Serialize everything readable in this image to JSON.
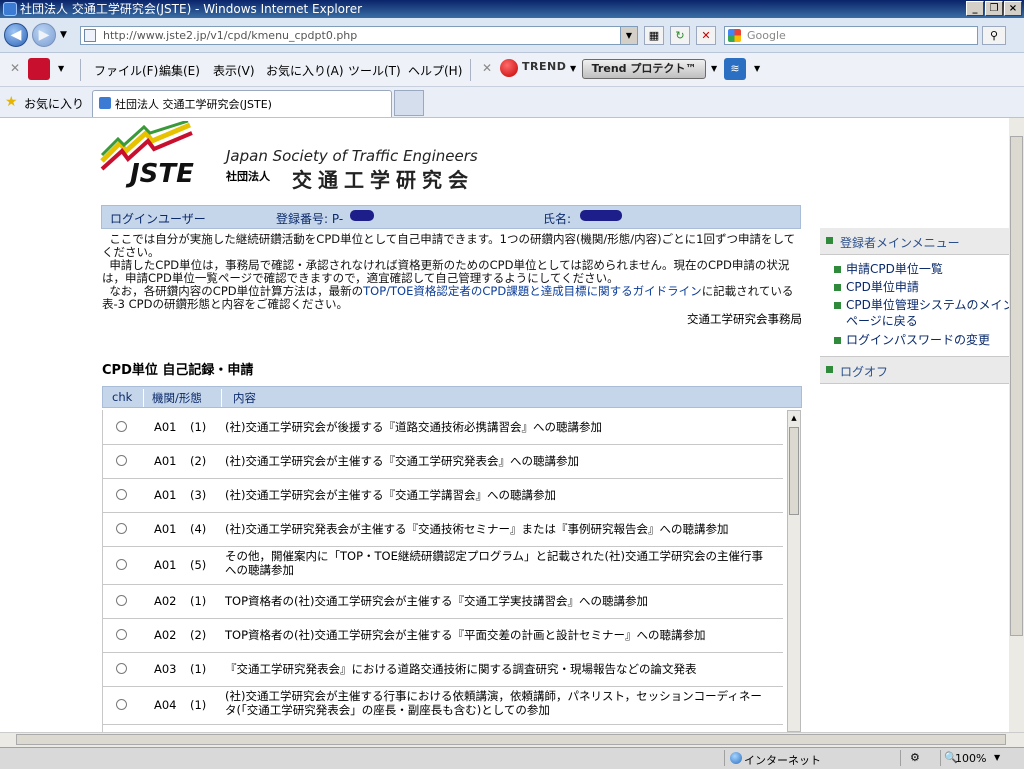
{
  "window": {
    "title": "社団法人 交通工学研究会(JSTE) - Windows Internet Explorer"
  },
  "browser": {
    "url": "http://www.jste2.jp/v1/cpd/kmenu_cpdpt0.php",
    "search_placeholder": "Google",
    "menu": [
      "ファイル(F)",
      "編集(E)",
      "表示(V)",
      "お気に入り(A)",
      "ツール(T)",
      "ヘルプ(H)"
    ],
    "trend_logo": "TREND",
    "trend_button": "Trend プロテクト™",
    "favorites_label": "お気に入り",
    "tab_title": "社団法人 交通工学研究会(JSTE)",
    "status_zone": "インターネット",
    "zoom": "100%"
  },
  "logo": {
    "mark": "JSTE",
    "english": "Japan Society of Traffic Engineers",
    "prefix": "社団法人",
    "name": "交通工学研究会"
  },
  "user_bar": {
    "login_user": "ログインユーザー",
    "reg_label": "登録番号: P-",
    "name_label": "氏名:"
  },
  "intro": {
    "p1": "ここでは自分が実施した継続研鑽活動をCPD単位として自己申請できます。1つの研鑽内容(機関/形態/内容)ごとに1回ずつ申請をしてください。",
    "p2": "申請したCPD単位は，事務局で確認・承認されなければ資格更新のためのCPD単位としては認められません。現在のCPD申請の状況は，申請CPD単位一覧ページで確認できますので，適宜確認して自己管理するようにしてください。",
    "p3_pre": "なお，各研鑽内容のCPD単位計算方法は，最新の",
    "p3_link": "TOP/TOE資格認定者のCPD課題と達成目標に関するガイドライン",
    "p3_post": "に記載されている表-3 CPDの研鑽形態と内容をご確認ください。",
    "office": "交通工学研究会事務局"
  },
  "section_title": "CPD単位 自己記録・申請",
  "table": {
    "headers": [
      "chk",
      "機関/形態",
      "内容"
    ],
    "rows": [
      {
        "code": "A01",
        "num": "(1)",
        "desc": "(社)交通工学研究会が後援する『道路交通技術必携講習会』への聴講参加"
      },
      {
        "code": "A01",
        "num": "(2)",
        "desc": "(社)交通工学研究会が主催する『交通工学研究発表会』への聴講参加"
      },
      {
        "code": "A01",
        "num": "(3)",
        "desc": "(社)交通工学研究会が主催する『交通工学講習会』への聴講参加"
      },
      {
        "code": "A01",
        "num": "(4)",
        "desc": "(社)交通工学研究発表会が主催する『交通技術セミナー』または『事例研究報告会』への聴講参加"
      },
      {
        "code": "A01",
        "num": "(5)",
        "desc": "その他，開催案内に「TOP・TOE継続研鑽認定プログラム」と記載された(社)交通工学研究会の主催行事への聴講参加"
      },
      {
        "code": "A02",
        "num": "(1)",
        "desc": "TOP資格者の(社)交通工学研究会が主催する『交通工学実技講習会』への聴講参加"
      },
      {
        "code": "A02",
        "num": "(2)",
        "desc": "TOP資格者の(社)交通工学研究会が主催する『平面交差の計画と設計セミナー』への聴講参加"
      },
      {
        "code": "A03",
        "num": "(1)",
        "desc": "『交通工学研究発表会』における道路交通技術に関する調査研究・現場報告などの論文発表"
      },
      {
        "code": "A04",
        "num": "(1)",
        "desc": "(社)交通工学研究会が主催する行事における依頼講演，依頼講師，パネリスト，セッションコーディネータ(「交通工学研究発表会」の座長・副座長も含む)としての参加"
      }
    ]
  },
  "right_menu": {
    "main_header": "登録者メインメニュー",
    "items": [
      "申請CPD単位一覧",
      "CPD単位申請",
      "CPD単位管理システムのメインページに戻る",
      "ログインパスワードの変更"
    ],
    "logoff": "ログオフ"
  },
  "colors": {
    "header_band": "#c6d6ea",
    "link": "#0a3c99",
    "menu_bullet": "#2f8a3c"
  }
}
